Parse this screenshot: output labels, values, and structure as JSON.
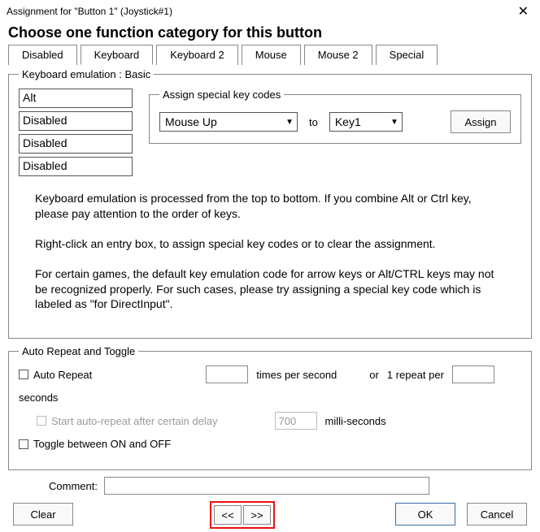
{
  "title": "Assignment for \"Button 1\" (Joystick#1)",
  "heading": "Choose one function category for this button",
  "tabs": [
    "Disabled",
    "Keyboard",
    "Keyboard 2",
    "Mouse",
    "Mouse 2",
    "Special"
  ],
  "activeTabIndex": 1,
  "keyboardPanel": {
    "legend": "Keyboard emulation : Basic",
    "slots": [
      "Alt",
      "Disabled",
      "Disabled",
      "Disabled"
    ],
    "assign": {
      "legend": "Assign special key codes",
      "source": "Mouse Up",
      "toLabel": "to",
      "target": "Key1",
      "button": "Assign"
    },
    "notes": [
      "Keyboard emulation is processed from the top to bottom.  If you combine Alt or Ctrl key, please pay attention to the order of keys.",
      "Right-click an entry box, to assign special key codes or to clear the assignment.",
      "For certain games, the default key emulation code for arrow keys or Alt/CTRL keys may not be recognized properly.  For such cases, please try assigning a special key code which is labeled as \"for DirectInput\"."
    ]
  },
  "autoRepeat": {
    "legend": "Auto Repeat and Toggle",
    "autoRepeatLabel": "Auto Repeat",
    "timesValue": "",
    "timesLabel": "times per second",
    "orLabel": "or",
    "repeatPerLabel": "1 repeat per",
    "secondsValue": "",
    "secondsLabel": "seconds",
    "startDelayLabel": "Start auto-repeat after certain delay",
    "delayValue": "700",
    "delayUnit": "milli-seconds",
    "toggleLabel": "Toggle between ON and OFF"
  },
  "commentLabel": "Comment:",
  "commentValue": "",
  "buttons": {
    "clear": "Clear",
    "prev": "<<",
    "next": ">>",
    "ok": "OK",
    "cancel": "Cancel"
  }
}
